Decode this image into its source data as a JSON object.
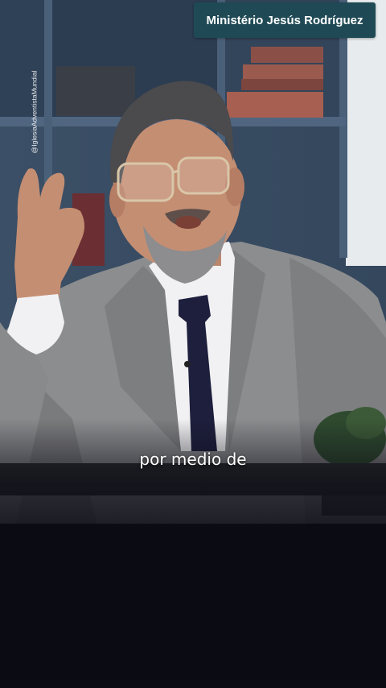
{
  "video": {
    "title_badge": "Ministério Jesús Rodríguez",
    "watermark": "@IglesiaAdventistaMundial",
    "caption": "por medio de"
  },
  "colors": {
    "badge_background": "#1f4a55",
    "bottom_background": "#0b0b14",
    "caption_text": "#ffffff"
  }
}
